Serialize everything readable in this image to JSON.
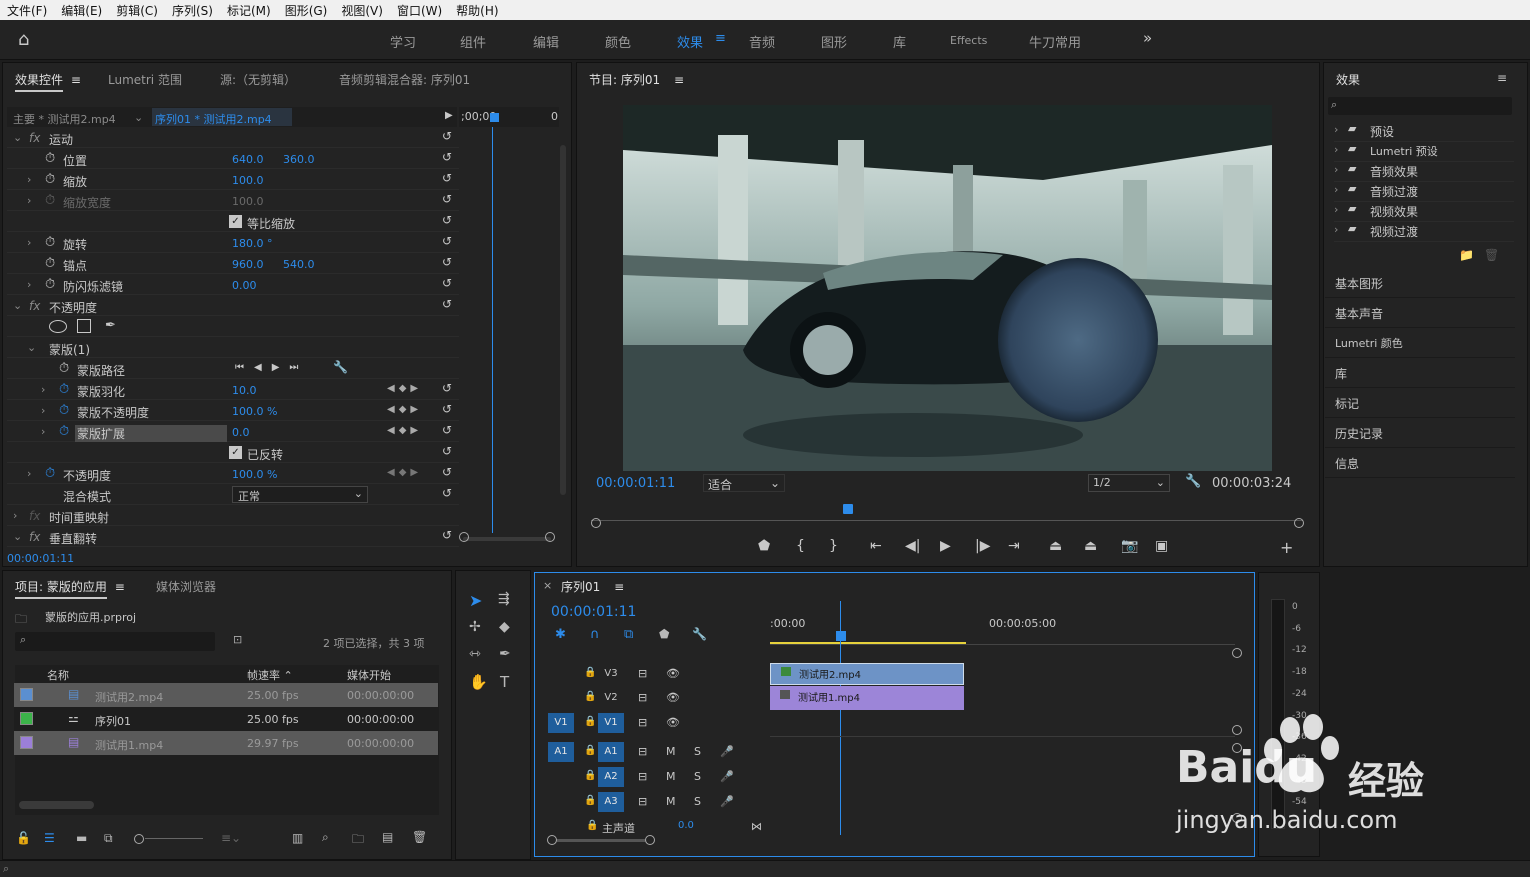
{
  "menu": [
    "文件(F)",
    "编辑(E)",
    "剪辑(C)",
    "序列(S)",
    "标记(M)",
    "图形(G)",
    "视图(V)",
    "窗口(W)",
    "帮助(H)"
  ],
  "workspaces": [
    "学习",
    "组件",
    "编辑",
    "颜色",
    "效果",
    "音频",
    "图形",
    "库",
    "Effects",
    "牛刀常用"
  ],
  "active_workspace": "效果",
  "effect_controls": {
    "tabs": [
      "效果控件",
      "Lumetri 范围",
      "源:（无剪辑）",
      "音频剪辑混合器: 序列01"
    ],
    "master": "主要 * 测试用2.mp4",
    "sequence": "序列01 * 测试用2.mp4",
    "ruler_time": ";00;00",
    "ruler_c": "0",
    "motion": "运动",
    "position": "位置",
    "position_x": "640.0",
    "position_y": "360.0",
    "scale": "缩放",
    "scale_val": "100.0",
    "scale_width": "缩放宽度",
    "scale_width_val": "100.0",
    "uniform_scale": "等比缩放",
    "rotation": "旋转",
    "rotation_val": "180.0 °",
    "anchor": "锚点",
    "anchor_x": "960.0",
    "anchor_y": "540.0",
    "antiflicker": "防闪烁滤镜",
    "antiflicker_val": "0.00",
    "opacity_group": "不透明度",
    "mask": "蒙版(1)",
    "mask_path": "蒙版路径",
    "mask_feather": "蒙版羽化",
    "mask_feather_val": "10.0",
    "mask_opacity": "蒙版不透明度",
    "mask_opacity_val": "100.0 %",
    "mask_expansion": "蒙版扩展",
    "mask_expansion_val": "0.0",
    "inverted": "已反转",
    "opacity": "不透明度",
    "opacity_val": "100.0 %",
    "blend_mode": "混合模式",
    "blend_mode_val": "正常",
    "time_remap": "时间重映射",
    "vertical_flip": "垂直翻转",
    "timecode": "00:00:01:11"
  },
  "program": {
    "title": "节目: 序列01",
    "timecode": "00:00:01:11",
    "fit": "适合",
    "resolution": "1/2",
    "duration": "00:00:03:24"
  },
  "effects_panel": {
    "title": "效果",
    "items": [
      "预设",
      "Lumetri 预设",
      "音频效果",
      "音频过渡",
      "视频效果",
      "视频过渡"
    ],
    "sections": [
      "基本图形",
      "基本声音",
      "Lumetri 颜色",
      "库",
      "标记",
      "历史记录",
      "信息"
    ]
  },
  "project": {
    "tabs": [
      "项目: 蒙版的应用",
      "媒体浏览器"
    ],
    "file": "蒙版的应用.prproj",
    "selection": "2 项已选择，共 3 项",
    "columns": [
      "名称",
      "帧速率",
      "媒体开始"
    ],
    "rows": [
      {
        "name": "测试用2.mp4",
        "fps": "25.00 fps",
        "start": "00:00:00:00",
        "color": "#5b8fd0"
      },
      {
        "name": "序列01",
        "fps": "25.00 fps",
        "start": "00:00:00:00",
        "color": "#3cb34a"
      },
      {
        "name": "测试用1.mp4",
        "fps": "29.97 fps",
        "start": "00:00:00:00",
        "color": "#9b7fd8"
      }
    ]
  },
  "timeline": {
    "tab": "序列01",
    "timecode": "00:00:01:11",
    "ruler": [
      ":00:00",
      "00:00:05:00"
    ],
    "tracks_video": [
      "V3",
      "V2",
      "V1"
    ],
    "tracks_audio": [
      "A1",
      "A2",
      "A3"
    ],
    "source_v": "V1",
    "source_a": "A1",
    "master": "主声道",
    "master_val": "0.0",
    "clip_top": "测试用2.mp4",
    "clip_bottom": "测试用1.mp4",
    "m": "M",
    "s": "S"
  },
  "meter_labels": [
    "0",
    "-6",
    "-12",
    "-18",
    "-24",
    "-30",
    "-36",
    "-42",
    "-48",
    "-54"
  ],
  "watermark": {
    "brand": "Baidu",
    "text": "经验",
    "url": "jingyan.baidu.com"
  }
}
